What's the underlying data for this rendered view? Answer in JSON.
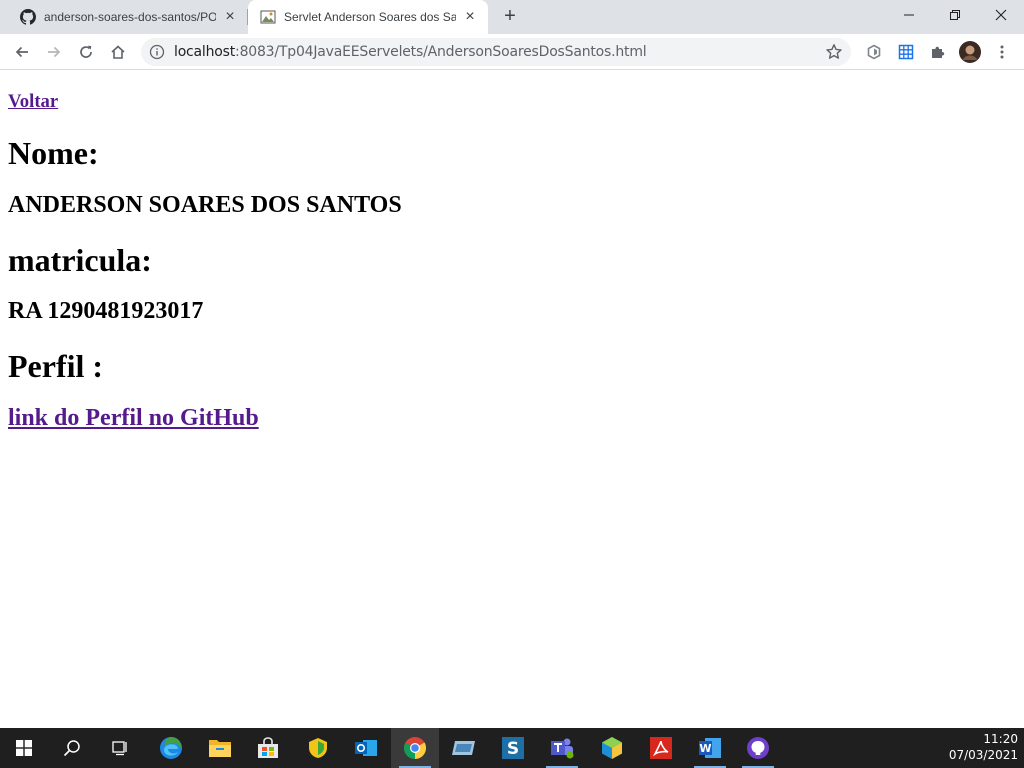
{
  "browser": {
    "tabs": [
      {
        "title": "anderson-soares-dos-santos/POO",
        "favicon": "github-icon",
        "active": false
      },
      {
        "title": "Servlet Anderson Soares dos Santos",
        "favicon": "page-image-icon",
        "active": true
      }
    ],
    "address_bar": {
      "host": "localhost",
      "path": ":8083/Tp04JavaEEServelets/AndersonSoaresDosSantos.html"
    },
    "window_controls": [
      "minimize-icon",
      "restore-icon",
      "close-icon"
    ],
    "extensions": [
      "extension-shield-icon",
      "grid-extension-icon",
      "puzzle-icon"
    ]
  },
  "page": {
    "back_link": "Voltar",
    "name_heading": "Nome:",
    "name_value": "ANDERSON SOARES DOS SANTOS",
    "matricula_heading": "matricula:",
    "matricula_value": "RA 1290481923017",
    "perfil_heading": "Perfil :",
    "github_link": "link do Perfil no GitHub"
  },
  "taskbar": {
    "apps": [
      "start-icon",
      "search-icon",
      "task-view-icon",
      "edge-icon",
      "file-explorer-icon",
      "store-icon",
      "kaspersky-icon",
      "outlook-icon",
      "chrome-icon",
      "apps-icon",
      "sourcetree-icon",
      "teams-icon",
      "virtualbox-icon",
      "acrobat-icon",
      "word-icon",
      "github-desktop-icon"
    ],
    "time": "11:20",
    "date": "07/03/2021"
  },
  "colors": {
    "tabstrip": "#dee1e6",
    "link_visited": "#551a8b",
    "taskbar": "#1f1f1f"
  }
}
